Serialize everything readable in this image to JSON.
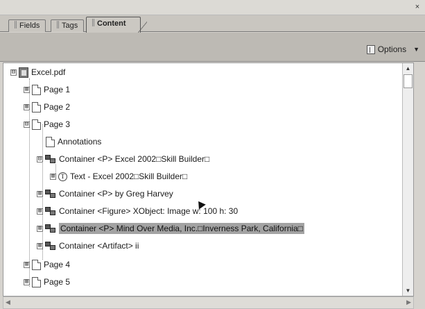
{
  "window": {
    "close_glyph": "×"
  },
  "tabs": [
    {
      "label": "Fields"
    },
    {
      "label": "Tags"
    },
    {
      "label": "Content"
    }
  ],
  "toolbar": {
    "options_label": "Options",
    "options_arrow": "▼"
  },
  "tree": {
    "root": {
      "label": "Excel.pdf",
      "expander": "⊟"
    },
    "rows": [
      {
        "label": "Page 1",
        "expander": "⊞",
        "icon": "page-icon"
      },
      {
        "label": "Page 2",
        "expander": "⊞",
        "icon": "page-icon"
      },
      {
        "label": "Page 3",
        "expander": "⊟",
        "icon": "page-icon"
      },
      {
        "label": "Annotations",
        "expander": "",
        "icon": "page-icon"
      },
      {
        "label": "Container <P> Excel 2002□Skill Builder□",
        "expander": "⊟",
        "icon": "container-icon"
      },
      {
        "label": "Text - Excel 2002□Skill Builder□",
        "expander": "⊞",
        "icon": "text-icon"
      },
      {
        "label": "Container <P> by Greg Harvey",
        "expander": "⊞",
        "icon": "container-icon"
      },
      {
        "label": "Container <Figure> XObject:  Image  w: 100 h: 30",
        "expander": "⊞",
        "icon": "container-icon"
      },
      {
        "label": "Container <P> Mind Over Media, Inc.□Inverness Park, California□",
        "expander": "⊞",
        "icon": "container-icon",
        "selected": true
      },
      {
        "label": "Container <Artifact> ii",
        "expander": "⊞",
        "icon": "container-icon"
      },
      {
        "label": "Page 4",
        "expander": "⊞",
        "icon": "page-icon"
      },
      {
        "label": "Page 5",
        "expander": "⊞",
        "icon": "page-icon"
      }
    ]
  },
  "scroll": {
    "up": "▲",
    "down": "▼",
    "left": "◀",
    "right": "▶"
  }
}
